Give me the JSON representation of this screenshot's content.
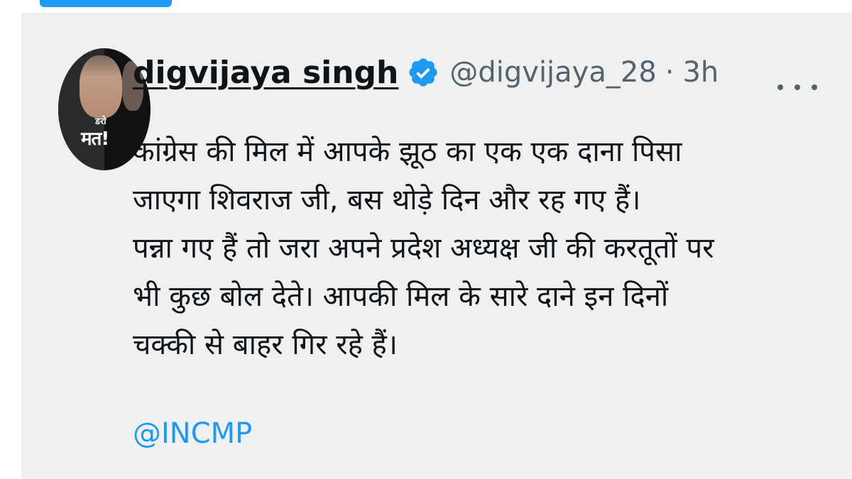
{
  "tweet": {
    "author": {
      "display_name": "digvijaya singh",
      "handle": "@digvijaya_28",
      "verified": true,
      "avatar": {
        "caption_small": "डरो",
        "caption_large": "मत!"
      }
    },
    "separator": "·",
    "timestamp": "3h",
    "more_icon": "more-horizontal-icon",
    "body_lines": [
      "कांग्रेस की मिल में आपके झूठ का एक एक दाना पिसा",
      "जाएगा शिवराज जी, बस थोड़े दिन और रह गए हैं।",
      "पन्ना गए हैं तो जरा अपने प्रदेश अध्यक्ष जी की करतूतों पर",
      "भी कुछ बोल देते। आपकी मिल के सारे दाने इन दिनों",
      "चक्की से बाहर गिर रहे हैं।"
    ],
    "mention": "@INCMP"
  },
  "colors": {
    "card_background": "#f0f0f0",
    "text_primary": "#0f1419",
    "text_secondary": "#536471",
    "accent_blue": "#1d9bf0"
  }
}
